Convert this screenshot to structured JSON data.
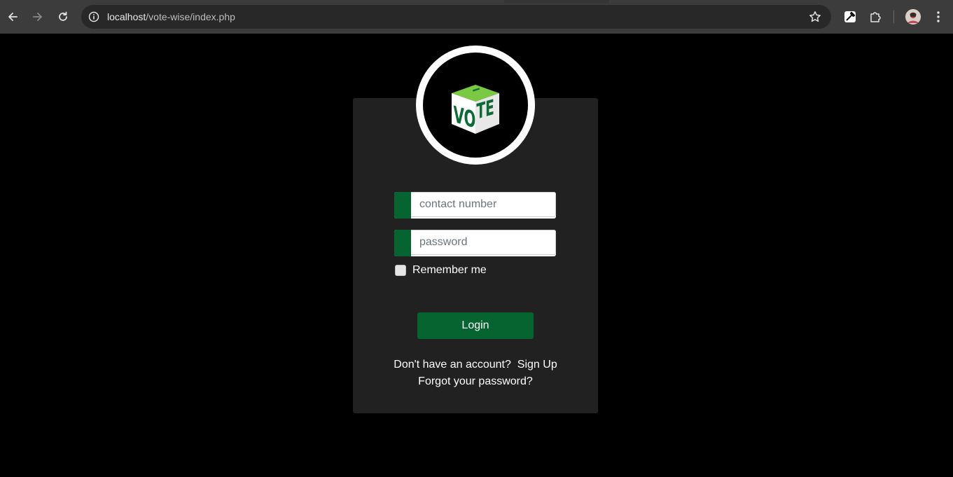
{
  "browser": {
    "url_host": "localhost",
    "url_path": "/vote-wise/index.php",
    "icons": [
      "back-arrow-icon",
      "forward-arrow-icon",
      "reload-icon",
      "site-info-icon",
      "bookmark-star-icon",
      "eyedropper-icon",
      "extensions-puzzle-icon",
      "profile-avatar",
      "more-vert-icon"
    ]
  },
  "logo": {
    "text": "VOTE",
    "colors": {
      "ring": "#ffffff",
      "box_top": "#7ac943",
      "box_front": "#ffffff",
      "letters": "#0b6a35"
    }
  },
  "form": {
    "contact_placeholder": "contact number",
    "password_placeholder": "password",
    "remember_label": "Remember me",
    "login_label": "Login"
  },
  "footer": {
    "no_account_text": "Don't have an account?",
    "signup_label": "Sign Up",
    "forgot_label": "Forgot your password?"
  },
  "colors": {
    "accent_green": "#066430",
    "card_bg": "#212121",
    "page_bg": "#000000"
  }
}
